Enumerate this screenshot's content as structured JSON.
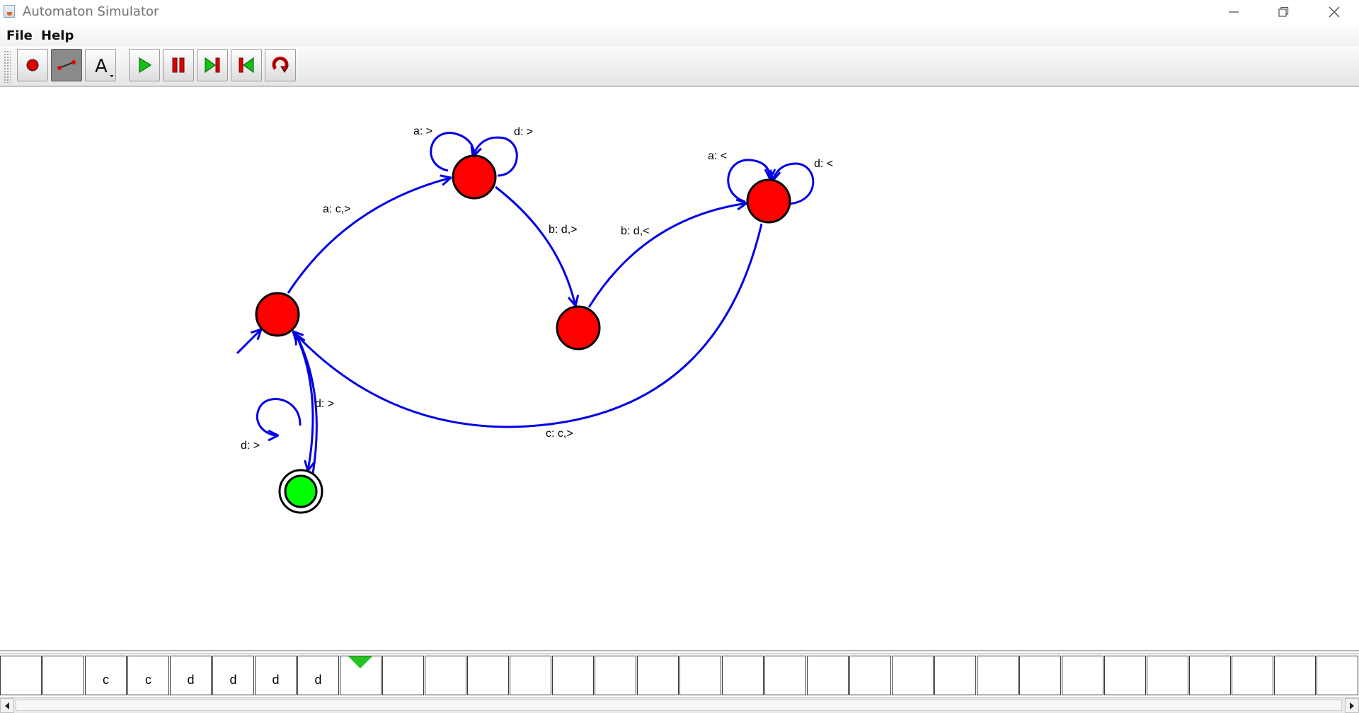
{
  "window": {
    "title": "Automaton Simulator",
    "controls": [
      "minimize",
      "maximize",
      "close"
    ]
  },
  "menu": {
    "items": [
      "File",
      "Help"
    ]
  },
  "toolbar": {
    "tools": [
      {
        "name": "add-state",
        "icon": "red-dot-icon",
        "pressed": false
      },
      {
        "name": "add-transition",
        "icon": "transition-line-icon",
        "pressed": true
      },
      {
        "name": "text-tool",
        "icon": "text-A-icon",
        "pressed": false,
        "label": "A"
      }
    ],
    "controls": [
      {
        "name": "play",
        "icon": "play-icon"
      },
      {
        "name": "pause",
        "icon": "pause-icon"
      },
      {
        "name": "step-forward",
        "icon": "step-forward-icon"
      },
      {
        "name": "step-back",
        "icon": "step-back-icon"
      },
      {
        "name": "reset",
        "icon": "reset-icon"
      }
    ]
  },
  "automaton": {
    "states": [
      {
        "id": "q0",
        "kind": "start",
        "color": "#ff0000"
      },
      {
        "id": "q1",
        "kind": "normal",
        "color": "#ff0000"
      },
      {
        "id": "q2",
        "kind": "normal",
        "color": "#ff0000"
      },
      {
        "id": "q3",
        "kind": "normal",
        "color": "#ff0000"
      },
      {
        "id": "q4",
        "kind": "accepting",
        "color": "#00ff00"
      }
    ],
    "edge_color": "#0000e6",
    "transitions": [
      {
        "from": "q0",
        "to": "q1",
        "label": "a: c,>"
      },
      {
        "from": "q1",
        "to": "q1",
        "label": "a: >"
      },
      {
        "from": "q1",
        "to": "q1",
        "label": "d: >"
      },
      {
        "from": "q1",
        "to": "q2",
        "label": "b: d,>"
      },
      {
        "from": "q2",
        "to": "q3",
        "label": "b: d,<"
      },
      {
        "from": "q3",
        "to": "q3",
        "label": "a: <"
      },
      {
        "from": "q3",
        "to": "q3",
        "label": "d: <"
      },
      {
        "from": "q3",
        "to": "q0",
        "label": "c: c,>"
      },
      {
        "from": "q0",
        "to": "q4",
        "label": "d: >"
      },
      {
        "from": "q4",
        "to": "q4",
        "label": "d: >"
      }
    ]
  },
  "tape": {
    "cells": [
      "",
      "",
      "c",
      "c",
      "d",
      "d",
      "d",
      "d",
      "",
      "",
      "",
      "",
      "",
      "",
      "",
      "",
      "",
      "",
      "",
      "",
      "",
      "",
      "",
      "",
      "",
      "",
      "",
      "",
      "",
      "",
      "",
      ""
    ],
    "head_index": 8,
    "head_color": "#22c422"
  }
}
